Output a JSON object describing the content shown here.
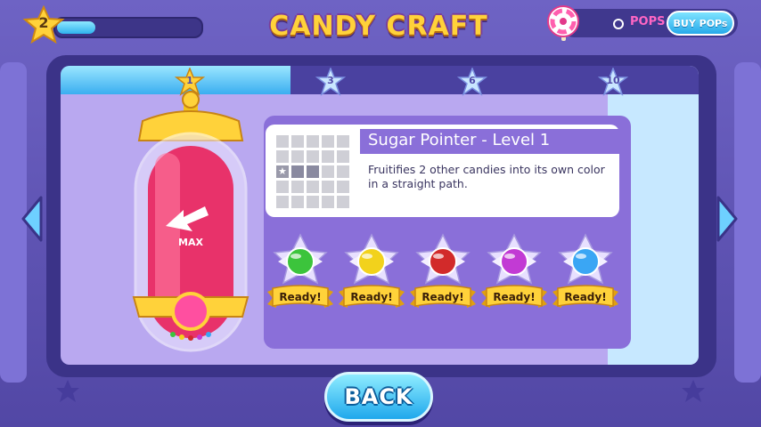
{
  "header": {
    "player_level": "2",
    "xp_progress": 0.27,
    "title": "CANDY CRAFT",
    "pops_count": "0",
    "pops_label": "POPS",
    "buy_pops_label": "BUY POPs"
  },
  "milestones": {
    "progress": 0.36,
    "items": [
      {
        "label": "1",
        "reached": true
      },
      {
        "label": "3",
        "reached": false
      },
      {
        "label": "6",
        "reached": false
      },
      {
        "label": "10",
        "reached": false
      }
    ]
  },
  "power_up": {
    "title": "Sugar Pointer - Level 1",
    "description": "Fruitifies 2 other candies into its own color in a straight path.",
    "tube_badge": "MAX",
    "icon": "arrow-pointer-icon"
  },
  "candies": [
    {
      "color": "#3cc43c",
      "status": "Ready!"
    },
    {
      "color": "#f2d21c",
      "status": "Ready!"
    },
    {
      "color": "#d22a2a",
      "status": "Ready!"
    },
    {
      "color": "#c23ad4",
      "status": "Ready!"
    },
    {
      "color": "#3aa6f4",
      "status": "Ready!"
    }
  ],
  "footer": {
    "back_label": "BACK"
  },
  "colors": {
    "accent_blue": "#2fb2ee",
    "title_yellow": "#ffd23a",
    "panel_purple": "#8a6fd9",
    "tube_pink": "#e8326a"
  }
}
